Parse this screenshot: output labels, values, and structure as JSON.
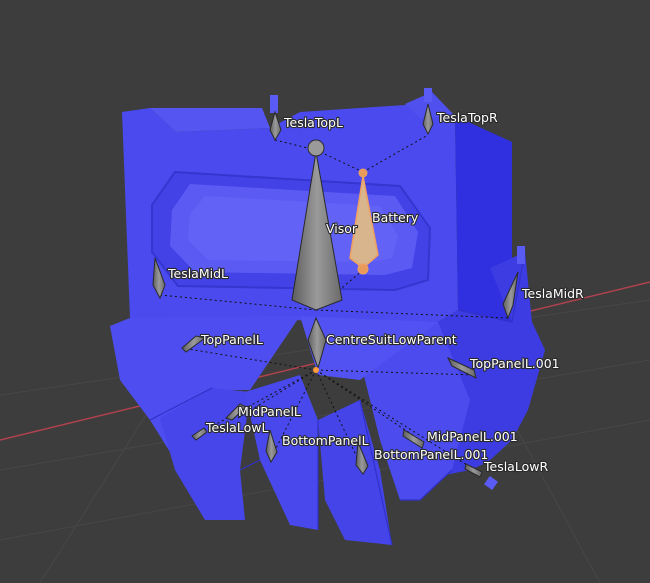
{
  "viewport": {
    "background": "#3d3d3d",
    "mesh_color": "#4b4bf0",
    "bone_color": "#8a8a8a",
    "selected_bone_color": "#e8b07a",
    "axis_x_color": "#b0424e"
  },
  "bones": {
    "tesla_top_l": "TeslaTopL",
    "tesla_top_r": "TeslaTopR",
    "visor": "Visor",
    "battery": "Battery",
    "tesla_mid_l": "TeslaMidL",
    "tesla_mid_r": "TeslaMidR",
    "top_panel_l": "TopPanelL",
    "centre_suit_low_parent": "CentreSuitLowParent",
    "top_panel_l_001": "TopPanelL.001",
    "mid_panel_l": "MidPanelL",
    "tesla_low_l": "TeslaLowL",
    "bottom_panel_l": "BottomPanelL",
    "mid_panel_l_001": "MidPanelL.001",
    "bottom_panel_l_001": "BottomPanelL.001",
    "tesla_low_r": "TeslaLowR"
  }
}
